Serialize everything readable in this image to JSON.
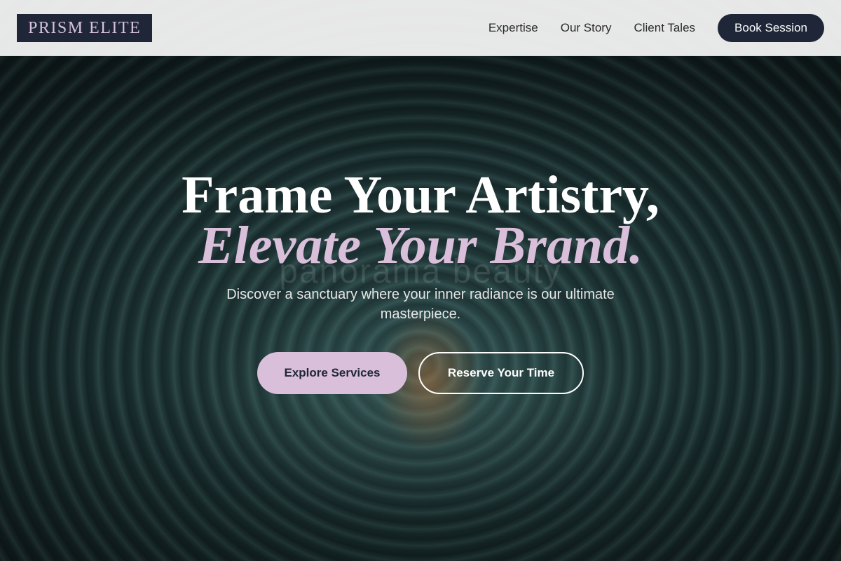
{
  "brand": {
    "name": "PRISM ELITE"
  },
  "nav": {
    "links": [
      "Expertise",
      "Our Story",
      "Client Tales"
    ],
    "cta_label": "Book Session"
  },
  "hero": {
    "headline_line1": "Frame Your Artistry,",
    "headline_line2": "Elevate Your Brand.",
    "subtitle": "Discover a sanctuary where your inner radiance is our ultimate masterpiece.",
    "primary_button": "Explore Services",
    "secondary_button": "Reserve Your Time",
    "watermark": "panorama beauty"
  },
  "colors": {
    "navy": "#1e2638",
    "lilac": "#d9bfd9",
    "nav_bg": "#f0f0f0"
  }
}
